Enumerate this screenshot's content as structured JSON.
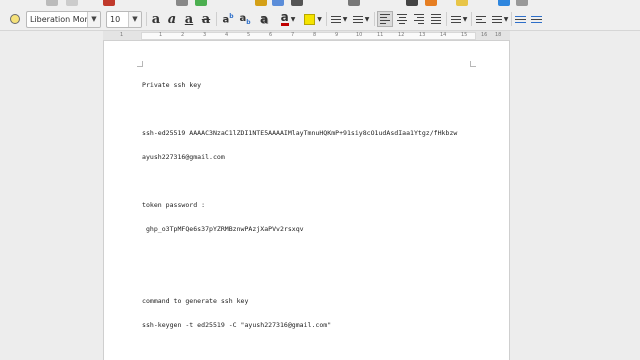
{
  "toolbar": {
    "font_name": "Liberation Mor",
    "font_size": "10",
    "icons": [
      "style-icon",
      "bold-icon",
      "italic-icon",
      "underline-icon",
      "strikethrough-icon",
      "superscript-icon",
      "subscript-icon",
      "shadow-icon",
      "font-color-icon",
      "highlight-icon",
      "bullets-icon",
      "numbering-icon",
      "align-left-icon",
      "align-center-icon",
      "align-right-icon",
      "justify-icon",
      "line-spacing-icon",
      "paragraph-icon",
      "increase-indent-icon",
      "decrease-indent-icon"
    ],
    "font_color": "#c00000",
    "highlight_color": "#f5e400"
  },
  "ruler": {
    "numbers": [
      "1",
      "1",
      "2",
      "3",
      "4",
      "5",
      "6",
      "7",
      "8",
      "9",
      "10",
      "11",
      "12",
      "13",
      "14",
      "15",
      "16",
      "18"
    ]
  },
  "document": {
    "lines": [
      "Private ssh key",
      "",
      "ssh-ed25519 AAAAC3NzaC1lZDI1NTE5AAAAIMlayTmnuHQKmP+91siy8cO1udAsdIaa1Ytgz/fHkbzw",
      "ayush227316@gmail.com",
      "",
      "token password :",
      " 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",
      "",
      "",
      "command to generate ssh key",
      "ssh-keygen -t ed25519 -C \"ayush227316@gmail.com\""
    ]
  }
}
